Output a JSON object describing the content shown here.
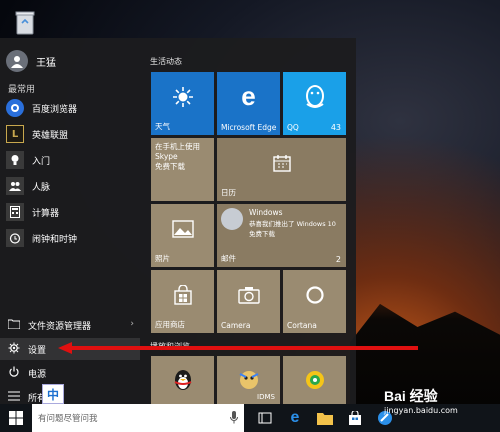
{
  "user": {
    "name": "王猛"
  },
  "most_used_label": "最常用",
  "apps": [
    {
      "label": "百度浏览器",
      "icon": "baidu-browser-icon"
    },
    {
      "label": "英雄联盟",
      "icon": "league-of-legends-icon"
    },
    {
      "label": "入门",
      "icon": "lightbulb-icon"
    },
    {
      "label": "人脉",
      "icon": "people-icon"
    },
    {
      "label": "计算器",
      "icon": "calculator-icon"
    },
    {
      "label": "闹钟和时钟",
      "icon": "alarm-clock-icon"
    }
  ],
  "bottom": {
    "file_explorer": "文件资源管理器",
    "settings": "设置",
    "power": "电源",
    "all_apps": "所有"
  },
  "tile_groups": {
    "life": "生活动态",
    "play": "播放和浏览"
  },
  "tiles": {
    "weather": "天气",
    "edge": "Microsoft Edge",
    "qq": "QQ",
    "qq_badge": "43",
    "skype_line1": "在手机上使用 Skype",
    "skype_line2": "免费下载",
    "calendar": "日历",
    "windows_title": "Windows",
    "windows_msg": "恭喜我们推出了 Windows 10",
    "windows_sub": "免费下载",
    "mail": "邮件",
    "mail_badge": "2",
    "photos": "照片",
    "store": "应用商店",
    "camera": "Camera",
    "cortana": "Cortana",
    "game_label": "IDMS"
  },
  "ime": "中",
  "taskbar": {
    "search_placeholder": "有问题尽管问我"
  },
  "watermark": {
    "logo": "Bai 经验",
    "url": "jingyan.baidu.com"
  },
  "colors": {
    "accent_blue": "#1a73c8",
    "qq_blue": "#1aa0e8",
    "tile_khaki": "#8a7b62",
    "arrow_red": "#e01010"
  }
}
